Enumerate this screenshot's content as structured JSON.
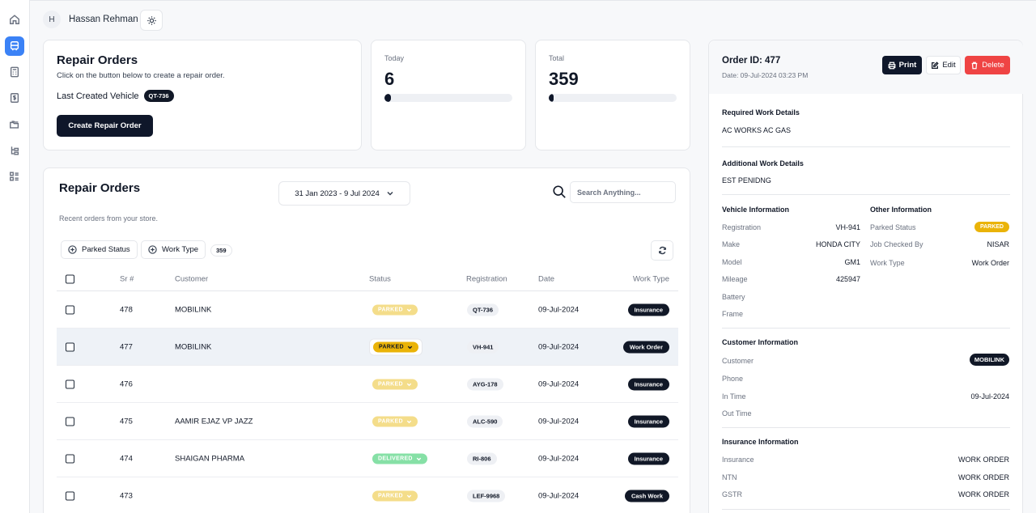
{
  "header": {
    "avatar_initial": "H",
    "user_name": "Hassan Rehman"
  },
  "nav": [
    "home-icon",
    "bus-icon",
    "calculator-icon",
    "receipt-icon",
    "folders-icon",
    "hierarchy-icon",
    "grid-list-icon"
  ],
  "hero": {
    "title": "Repair Orders",
    "subtitle": "Click on the button below to create a repair order.",
    "last_vehicle_label": "Last Created Vehicle",
    "last_vehicle": "QT-736",
    "create_button": "Create Repair Order"
  },
  "stats": {
    "today": {
      "label": "Today",
      "value": "6",
      "progress": 0.05
    },
    "total": {
      "label": "Total",
      "value": "359",
      "progress": 0.04
    }
  },
  "list": {
    "title": "Repair Orders",
    "subtitle": "Recent orders from your store.",
    "date_range": "31 Jan 2023 - 9 Jul 2024",
    "search_placeholder": "Search Anything...",
    "filters": {
      "parked_status": "Parked Status",
      "work_type": "Work Type",
      "count": "359"
    },
    "columns": {
      "sr": "Sr #",
      "customer": "Customer",
      "status": "Status",
      "registration": "Registration",
      "date": "Date",
      "work_type": "Work Type"
    },
    "rows": [
      {
        "sr": "478",
        "customer": "MOBILINK",
        "status": "PARKED",
        "registration": "QT-736",
        "date": "09-Jul-2024",
        "work_type": "Insurance"
      },
      {
        "sr": "477",
        "customer": "MOBILINK",
        "status": "PARKED",
        "registration": "VH-941",
        "date": "09-Jul-2024",
        "work_type": "Work Order"
      },
      {
        "sr": "476",
        "customer": "",
        "status": "PARKED",
        "registration": "AYG-178",
        "date": "09-Jul-2024",
        "work_type": "Insurance"
      },
      {
        "sr": "475",
        "customer": "AAMIR EJAZ VP JAZZ",
        "status": "PARKED",
        "registration": "ALC-590",
        "date": "09-Jul-2024",
        "work_type": "Insurance"
      },
      {
        "sr": "474",
        "customer": "SHAIGAN PHARMA",
        "status": "DELIVERED",
        "registration": "RI-806",
        "date": "09-Jul-2024",
        "work_type": "Insurance"
      },
      {
        "sr": "473",
        "customer": "",
        "status": "PARKED",
        "registration": "LEF-9968",
        "date": "09-Jul-2024",
        "work_type": "Cash Work"
      }
    ]
  },
  "detail": {
    "order_id": "Order ID: 477",
    "date": "Date: 09-Jul-2024 03:23 PM",
    "actions": {
      "print": "Print",
      "edit": "Edit",
      "delete": "Delete"
    },
    "required_title": "Required Work Details",
    "required_text": "AC WORKS AC GAS",
    "additional_title": "Additional Work Details",
    "additional_text": "EST PENIDNG",
    "vehicle_title": "Vehicle Information",
    "vehicle": [
      {
        "k": "Registration",
        "v": "VH-941"
      },
      {
        "k": "Make",
        "v": "HONDA CITY"
      },
      {
        "k": "Model",
        "v": "GM1"
      },
      {
        "k": "Mileage",
        "v": "425947"
      },
      {
        "k": "Battery",
        "v": ""
      },
      {
        "k": "Frame",
        "v": ""
      }
    ],
    "other_title": "Other Information",
    "other": [
      {
        "k": "Parked Status",
        "v": "PARKED"
      },
      {
        "k": "Job Checked By",
        "v": "NISAR"
      },
      {
        "k": "Work Type",
        "v": "Work Order"
      }
    ],
    "customer_title": "Customer Information",
    "customer": [
      {
        "k": "Customer",
        "v": "MOBILINK"
      },
      {
        "k": "Phone",
        "v": ""
      },
      {
        "k": "In Time",
        "v": "09-Jul-2024"
      },
      {
        "k": "Out Time",
        "v": ""
      }
    ],
    "insurance_title": "Insurance Information",
    "insurance": [
      {
        "k": "Insurance",
        "v": "WORK ORDER"
      },
      {
        "k": "NTN",
        "v": "WORK ORDER"
      },
      {
        "k": "GSTR",
        "v": "WORK ORDER"
      }
    ]
  }
}
